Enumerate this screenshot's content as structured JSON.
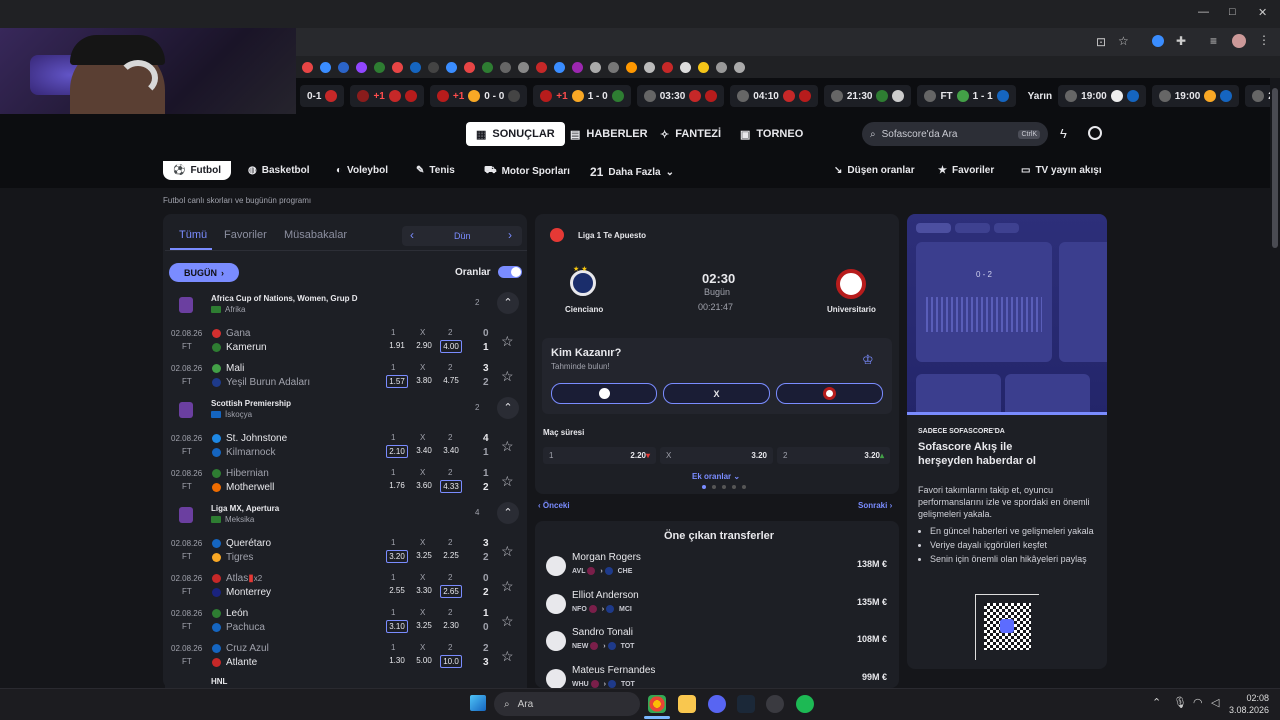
{
  "browser": {
    "window_controls": [
      "—",
      "□",
      "✕"
    ],
    "bookmark_colors": [
      "#e84545",
      "#3a8dff",
      "#2b64c8",
      "#9146ff",
      "#2e7d32",
      "#e84545",
      "#1565c0",
      "#444",
      "#3a8dff",
      "#e84545",
      "#2e7d32",
      "#666",
      "#888",
      "#c62828",
      "#3a8dff",
      "#9c27b0",
      "#aaa",
      "#777",
      "#ff9800",
      "#bbb",
      "#c62828",
      "#ddd",
      "#f5c518",
      "#999",
      "#aaa"
    ]
  },
  "livebar": {
    "items": [
      {
        "left": "0-1",
        "right": "",
        "live": false
      },
      {
        "left": "",
        "right": "",
        "score": "+1",
        "live": true
      },
      {
        "left": "0 - 0",
        "score": "+1",
        "live": true
      },
      {
        "left": "1 - 0",
        "score": "+1",
        "live": true
      },
      {
        "left": "03:30"
      },
      {
        "left": "04:10"
      },
      {
        "left": "21:30"
      },
      {
        "left": "FT",
        "score": "1 - 1"
      }
    ],
    "yarin": "Yarın",
    "upcoming": [
      "19:00",
      "19:00",
      "2"
    ]
  },
  "header": {
    "nav": [
      {
        "label": "SONUÇLAR",
        "icon": "results-icon"
      },
      {
        "label": "HABERLER",
        "icon": "news-icon"
      },
      {
        "label": "FANTEZİ",
        "icon": "fantasy-icon"
      },
      {
        "label": "TORNEO",
        "icon": "trophy-icon"
      }
    ],
    "search_placeholder": "Sofascore'da Ara",
    "search_shortcut": "CtrlK"
  },
  "sports": {
    "items": [
      "Futbol",
      "Basketbol",
      "Voleybol",
      "Tenis",
      "Motor Sporları",
      "21",
      "Daha Fazla"
    ],
    "right": [
      "Düşen oranlar",
      "Favoriler",
      "TV yayın akışı"
    ]
  },
  "subtitle": "Futbol canlı skorları ve bugünün programı",
  "left": {
    "tabs": [
      "Tümü",
      "Favoriler",
      "Müsabakalar"
    ],
    "day": "Dün",
    "today_btn": "BUGÜN",
    "odds_label": "Oranlar",
    "leagues": [
      {
        "name": "Africa Cup of Nations, Women, Grup D",
        "region": "Afrika",
        "count": "2",
        "flag": "#2e7d32",
        "matches": [
          {
            "date": "02.08.26",
            "status": "FT",
            "home": "Gana",
            "away": "Kamerun",
            "o1": "1.91",
            "ox": "2.90",
            "o2": "4.00",
            "hl": 2,
            "hs": "0",
            "as": "1",
            "hc": "#d32f2f",
            "ac": "#2e7d32"
          },
          {
            "date": "02.08.26",
            "status": "FT",
            "home": "Mali",
            "away": "Yeşil Burun Adaları",
            "o1": "1.57",
            "ox": "3.80",
            "o2": "4.75",
            "hl": 0,
            "hs": "3",
            "as": "2",
            "hc": "#43a047",
            "ac": "#1e3a8a"
          }
        ]
      },
      {
        "name": "Scottish Premiership",
        "region": "İskoçya",
        "count": "2",
        "flag": "#1565c0",
        "matches": [
          {
            "date": "02.08.26",
            "status": "FT",
            "home": "St. Johnstone",
            "away": "Kilmarnock",
            "o1": "2.10",
            "ox": "3.40",
            "o2": "3.40",
            "hl": 0,
            "hs": "4",
            "as": "1",
            "hc": "#1e88e5",
            "ac": "#1565c0"
          },
          {
            "date": "02.08.26",
            "status": "FT",
            "home": "Hibernian",
            "away": "Motherwell",
            "o1": "1.76",
            "ox": "3.60",
            "o2": "4.33",
            "hl": 2,
            "hs": "1",
            "as": "2",
            "hc": "#2e7d32",
            "ac": "#ef6c00"
          }
        ]
      },
      {
        "name": "Liga MX, Apertura",
        "region": "Meksika",
        "count": "4",
        "flag": "#2e7d32",
        "matches": [
          {
            "date": "02.08.26",
            "status": "FT",
            "home": "Querétaro",
            "away": "Tigres",
            "o1": "3.20",
            "ox": "3.25",
            "o2": "2.25",
            "hl": 0,
            "hs": "3",
            "as": "2",
            "hc": "#1565c0",
            "ac": "#f9a825"
          },
          {
            "date": "02.08.26",
            "status": "FT",
            "home": "Atlas",
            "away": "Monterrey",
            "o1": "2.55",
            "ox": "3.30",
            "o2": "2.65",
            "hl": 2,
            "hs": "0",
            "as": "2",
            "hc": "#c62828",
            "ac": "#1a237e",
            "hnote": "x2"
          },
          {
            "date": "02.08.26",
            "status": "FT",
            "home": "León",
            "away": "Pachuca",
            "o1": "3.10",
            "ox": "3.25",
            "o2": "2.30",
            "hl": 0,
            "hs": "1",
            "as": "0",
            "hc": "#2e7d32",
            "ac": "#1565c0"
          },
          {
            "date": "02.08.26",
            "status": "FT",
            "home": "Cruz Azul",
            "away": "Atlante",
            "o1": "1.30",
            "ox": "5.00",
            "o2": "10.0",
            "hl": 2,
            "hs": "2",
            "as": "3",
            "hc": "#1565c0",
            "ac": "#c62828"
          }
        ]
      }
    ],
    "next_league": "HNL",
    "odds_headers": [
      "1",
      "X",
      "2"
    ]
  },
  "center": {
    "league": "Liga 1 Te Apuesto",
    "home": "Cienciano",
    "away": "Universitario",
    "time": "02:30",
    "day": "Bugün",
    "countdown": "00:21:47",
    "predict_title": "Kim Kazanır?",
    "predict_sub": "Tahminde bulun!",
    "predict_mid": "X",
    "odds_title": "Maç süresi",
    "odds": [
      {
        "k": "1",
        "v": "2.20",
        "dir": "down"
      },
      {
        "k": "X",
        "v": "3.20",
        "dir": ""
      },
      {
        "k": "2",
        "v": "3.20",
        "dir": "up"
      }
    ],
    "more_odds": "Ek oranlar",
    "prev": "Önceki",
    "next": "Sonraki",
    "transfers_title": "Öne çıkan transferler",
    "transfers": [
      {
        "name": "Morgan Rogers",
        "from": "AVL",
        "to": "CHE",
        "fee": "138M €"
      },
      {
        "name": "Elliot Anderson",
        "from": "NFO",
        "to": "MCI",
        "fee": "135M €"
      },
      {
        "name": "Sandro Tonali",
        "from": "NEW",
        "to": "TOT",
        "fee": "108M €"
      },
      {
        "name": "Mateus Fernandes",
        "from": "WHU",
        "to": "TOT",
        "fee": "99M €"
      }
    ]
  },
  "right": {
    "promo_label": "SADECE SOFASCORE'DA",
    "promo_title": "Sofascore Akış ile herşeyden haberdar ol",
    "promo_text": "Favori takımlarını takip et, oyuncu performanslarını izle ve spordaki en önemli gelişmeleri yakala.",
    "bullets": [
      "En güncel haberleri ve gelişmeleri yakala",
      "Veriye dayalı içgörüleri keşfet",
      "Senin için önemli olan hikâyeleri paylaş"
    ],
    "card_score": "0 - 2"
  },
  "taskbar": {
    "search": "Ara",
    "time": "02:08",
    "date": "3.08.2026"
  }
}
